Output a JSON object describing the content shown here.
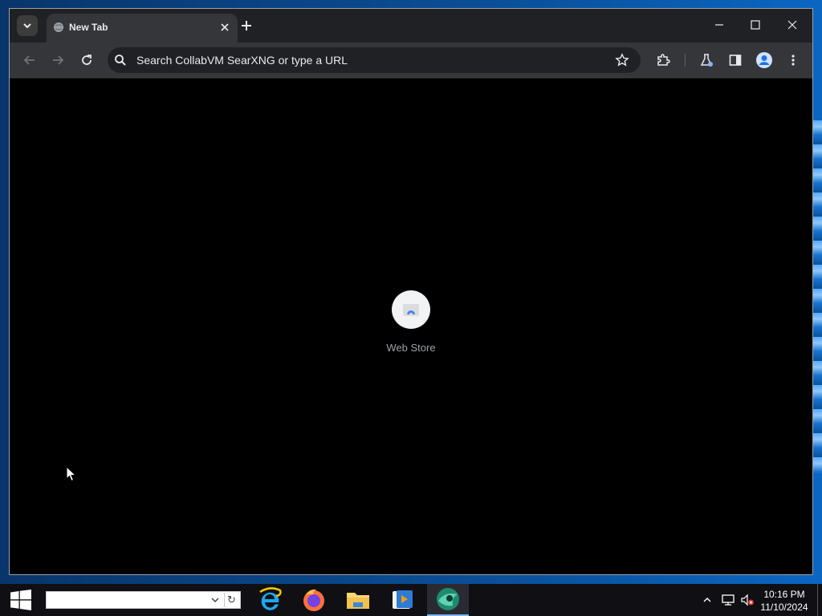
{
  "browser": {
    "tab": {
      "title": "New Tab"
    },
    "omnibox": {
      "placeholder": "Search CollabVM SearXNG or type a URL"
    },
    "shortcuts": [
      {
        "label": "Web Store"
      }
    ]
  },
  "taskbar": {
    "address_value": "",
    "apps": [
      "internet-explorer",
      "firefox",
      "file-explorer",
      "media-player",
      "browser-active"
    ],
    "clock": {
      "time": "10:16 PM",
      "date": "11/10/2024"
    }
  },
  "colors": {
    "chrome_dark": "#202124",
    "toolbar": "#35363a",
    "taskbar": "#101014",
    "accent": "#76b9ed"
  }
}
